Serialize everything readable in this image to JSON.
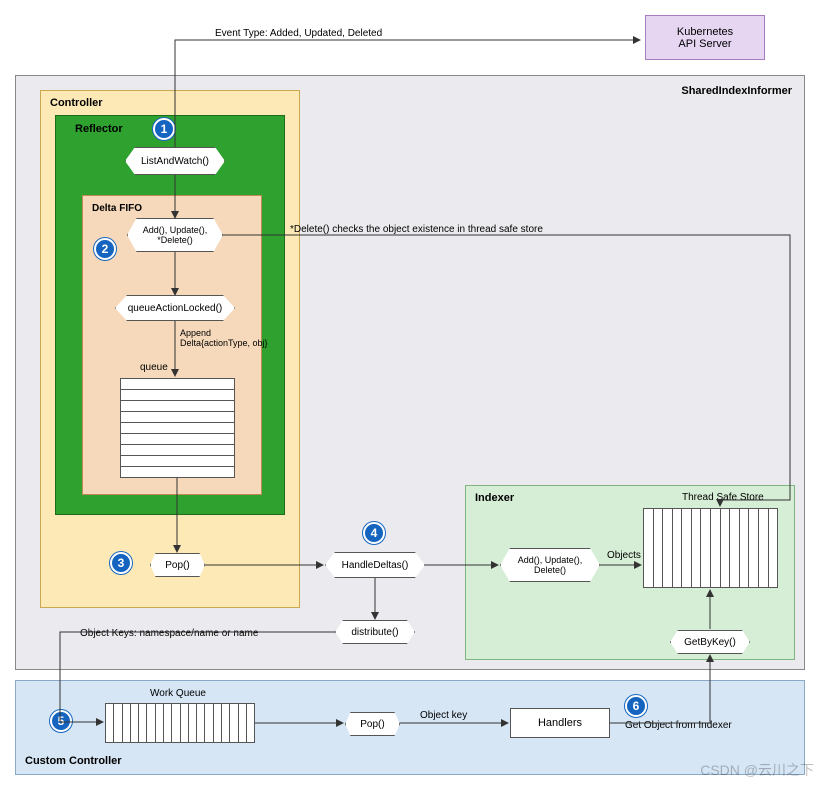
{
  "topArrowLabel": "Event Type: Added, Updated, Deleted",
  "k8sBox": "Kubernetes\nAPI Server",
  "sharedIndexInformer": "SharedIndexInformer",
  "controller": "Controller",
  "reflector": "Reflector",
  "deltaFifo": "Delta FIFO",
  "badges": {
    "b1": "1",
    "b2": "2",
    "b3": "3",
    "b4": "4",
    "b5": "5",
    "b6": "6"
  },
  "listAndWatch": "ListAndWatch()",
  "addUpdateDelete": "Add(), Update(),\n*Delete()",
  "deleteNote": "*Delete() checks the object existence in thread safe store",
  "queueActionLocked": "queueActionLocked()",
  "appendDelta": "Append\nDelta{actionType, obj}",
  "queueLabel": "queue",
  "pop1": "Pop()",
  "handleDeltas": "HandleDeltas()",
  "indexer": "Indexer",
  "threadSafeStore": "Thread Safe Store",
  "addUpDel2": "Add(), Update(),\nDelete()",
  "objects": "Objects",
  "distribute": "distribute()",
  "objectKeys": "Object Keys: namespace/name or name",
  "getByKey": "GetByKey()",
  "workQueue": "Work Queue",
  "pop2": "Pop()",
  "objectKey": "Object key",
  "handlers": "Handlers",
  "getObjectFromIndexer": "Get Object from Indexer",
  "customController": "Custom Controller",
  "watermark": "CSDN @云川之下",
  "chart_data": {
    "type": "diagram",
    "title": "SharedIndexInformer / Custom Controller flow",
    "containers": [
      {
        "id": "SharedIndexInformer",
        "contains": [
          "Controller",
          "Indexer"
        ]
      },
      {
        "id": "Controller",
        "contains": [
          "Reflector"
        ]
      },
      {
        "id": "Reflector",
        "contains": [
          "Delta FIFO",
          "ListAndWatch()"
        ]
      },
      {
        "id": "Delta FIFO",
        "contains": [
          "Add()/Update()/*Delete()",
          "queueActionLocked()",
          "queue"
        ]
      },
      {
        "id": "Indexer",
        "contains": [
          "Add()/Update()/Delete()",
          "Thread Safe Store",
          "GetByKey()"
        ]
      },
      {
        "id": "Custom Controller",
        "contains": [
          "Work Queue",
          "Pop()",
          "Handlers"
        ]
      }
    ],
    "nodes": [
      {
        "id": "K8sAPI",
        "label": "Kubernetes API Server"
      },
      {
        "id": "ListAndWatch",
        "label": "ListAndWatch()",
        "badge": 1
      },
      {
        "id": "DeltaAddUpdDel",
        "label": "Add(), Update(), *Delete()",
        "badge": 2
      },
      {
        "id": "queueActionLocked",
        "label": "queueActionLocked()"
      },
      {
        "id": "queue",
        "label": "queue"
      },
      {
        "id": "Pop",
        "label": "Pop()",
        "badge": 3
      },
      {
        "id": "HandleDeltas",
        "label": "HandleDeltas()",
        "badge": 4
      },
      {
        "id": "distribute",
        "label": "distribute()"
      },
      {
        "id": "IdxAddUpdDel",
        "label": "Add(), Update(), Delete()"
      },
      {
        "id": "ThreadSafeStore",
        "label": "Thread Safe Store"
      },
      {
        "id": "GetByKey",
        "label": "GetByKey()"
      },
      {
        "id": "WorkQueue",
        "label": "Work Queue",
        "badge": 5
      },
      {
        "id": "Pop2",
        "label": "Pop()"
      },
      {
        "id": "Handlers",
        "label": "Handlers",
        "badge": 6
      }
    ],
    "edges": [
      {
        "from": "ListAndWatch",
        "to": "K8sAPI",
        "label": "Event Type: Added, Updated, Deleted"
      },
      {
        "from": "ListAndWatch",
        "to": "DeltaAddUpdDel"
      },
      {
        "from": "DeltaAddUpdDel",
        "to": "ThreadSafeStore",
        "label": "*Delete() checks the object existence in thread safe store"
      },
      {
        "from": "DeltaAddUpdDel",
        "to": "queueActionLocked"
      },
      {
        "from": "queueActionLocked",
        "to": "queue",
        "label": "Append Delta{actionType, obj}"
      },
      {
        "from": "queue",
        "to": "Pop"
      },
      {
        "from": "Pop",
        "to": "HandleDeltas"
      },
      {
        "from": "HandleDeltas",
        "to": "IdxAddUpdDel"
      },
      {
        "from": "IdxAddUpdDel",
        "to": "ThreadSafeStore",
        "label": "Objects"
      },
      {
        "from": "HandleDeltas",
        "to": "distribute"
      },
      {
        "from": "distribute",
        "to": "WorkQueue",
        "label": "Object Keys: namespace/name or name"
      },
      {
        "from": "WorkQueue",
        "to": "Pop2"
      },
      {
        "from": "Pop2",
        "to": "Handlers",
        "label": "Object key"
      },
      {
        "from": "Handlers",
        "to": "GetByKey",
        "label": "Get Object from Indexer"
      },
      {
        "from": "GetByKey",
        "to": "ThreadSafeStore"
      }
    ]
  }
}
